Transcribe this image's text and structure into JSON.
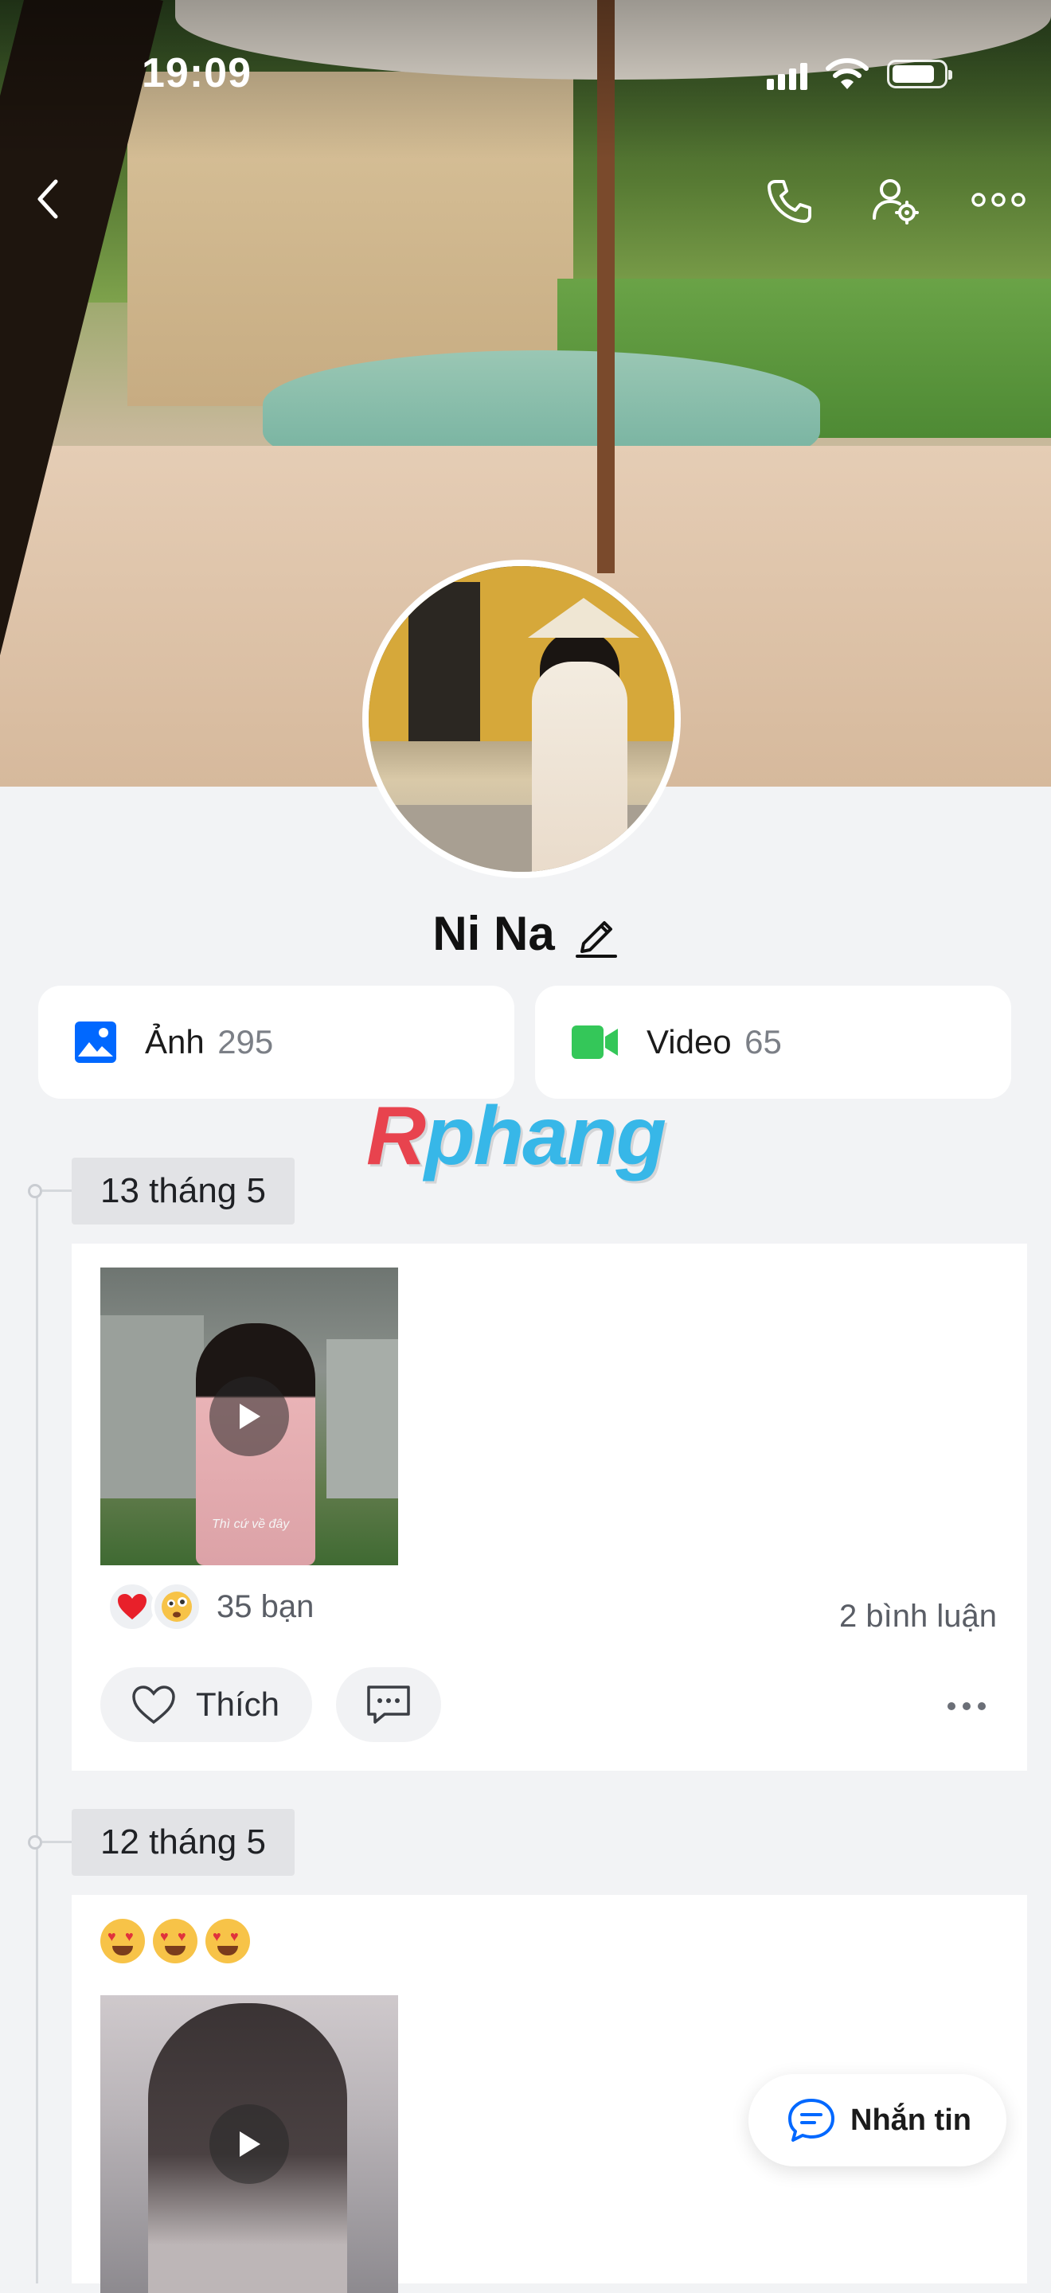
{
  "status_bar": {
    "time": "19:09"
  },
  "profile": {
    "name": "Ni Na"
  },
  "media": {
    "photos": {
      "label": "Ảnh",
      "count": "295"
    },
    "videos": {
      "label": "Video",
      "count": "65"
    }
  },
  "watermark": {
    "text_a": "R",
    "text_b": "phang"
  },
  "posts": [
    {
      "date": "13 tháng 5",
      "thumbnail_caption": "Thì cứ về đây",
      "reactions": [
        "heart",
        "flushed-face"
      ],
      "reaction_count": "35 bạn",
      "comments": "2 bình luận",
      "like_label": "Thích"
    },
    {
      "date": "12 tháng 5",
      "text": "😍😍😍"
    }
  ],
  "fab": {
    "label": "Nhắn tin"
  },
  "colors": {
    "accent": "#0068ff",
    "video_green": "#34c759",
    "like_bg": "#f1f2f4"
  }
}
